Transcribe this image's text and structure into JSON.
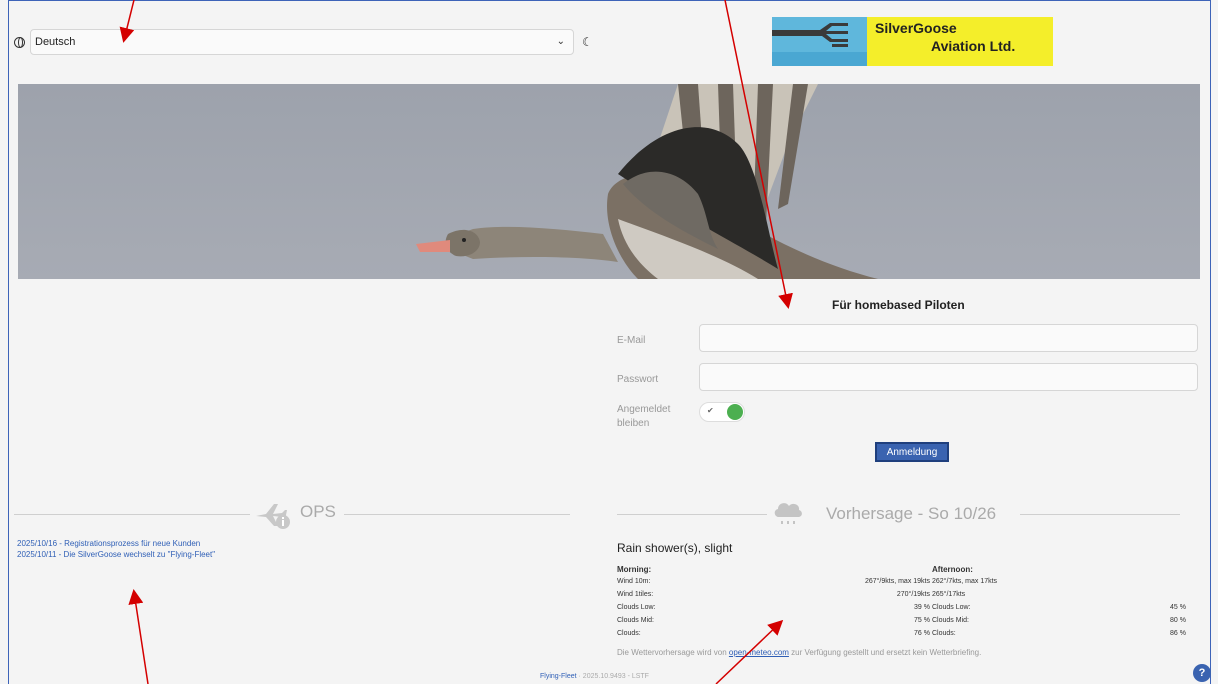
{
  "header": {
    "language": {
      "selected": "Deutsch",
      "icon": "globe-icon"
    },
    "theme_icon": "moon-icon",
    "logo": {
      "line1": "SilverGoose",
      "line2": "Aviation Ltd."
    }
  },
  "login": {
    "title": "Für homebased Piloten",
    "email_label": "E-Mail",
    "password_label": "Passwort",
    "remember_label": "Angemeldet bleiben",
    "toggle_on": true,
    "button": "Anmeldung"
  },
  "ops": {
    "title": "OPS",
    "news": [
      "2025/10/16 - Registrationsprozess für neue Kunden",
      "2025/10/11 - Die SilverGoose wechselt zu \"Flying-Fleet\""
    ]
  },
  "weather": {
    "title": "Vorhersage - So 10/26",
    "summary": "Rain shower(s), slight",
    "morning": "Morning:",
    "afternoon": "Afternoon:",
    "morning_rows": [
      {
        "label": "Wind 10m:",
        "value": "267°/9kts, max 19kts"
      },
      {
        "label": "Wind 1tiles:",
        "value": "270°/19kts"
      },
      {
        "label": "Clouds Low:",
        "value": "39 %"
      },
      {
        "label": "Clouds Mid:",
        "value": "75 %"
      },
      {
        "label": "Clouds:",
        "value": "76 %"
      }
    ],
    "afternoon_rows": [
      {
        "label": "",
        "value": "262°/7kts, max 17kts"
      },
      {
        "label": "",
        "value": "265°/17kts"
      },
      {
        "label": "Clouds Low:",
        "value": "45 %"
      },
      {
        "label": "Clouds Mid:",
        "value": "80 %"
      },
      {
        "label": "Clouds:",
        "value": "86 %"
      }
    ],
    "note_before": "Die Wettervorhersage wird von ",
    "note_link": "open-meteo.com",
    "note_after": " zur Verfügung gestellt und ersetzt kein Wetterbriefing."
  },
  "footer": {
    "link": "Flying-Fleet",
    "version": " · 2025.10.9493 - LSTF"
  },
  "help_label": "?",
  "colors": {
    "accent": "#3a63b0",
    "logo_yellow": "#f4ee2a",
    "logo_blue": "#5fb7dc",
    "toggle_green": "#4caf50",
    "arrow_red": "#d40000"
  }
}
